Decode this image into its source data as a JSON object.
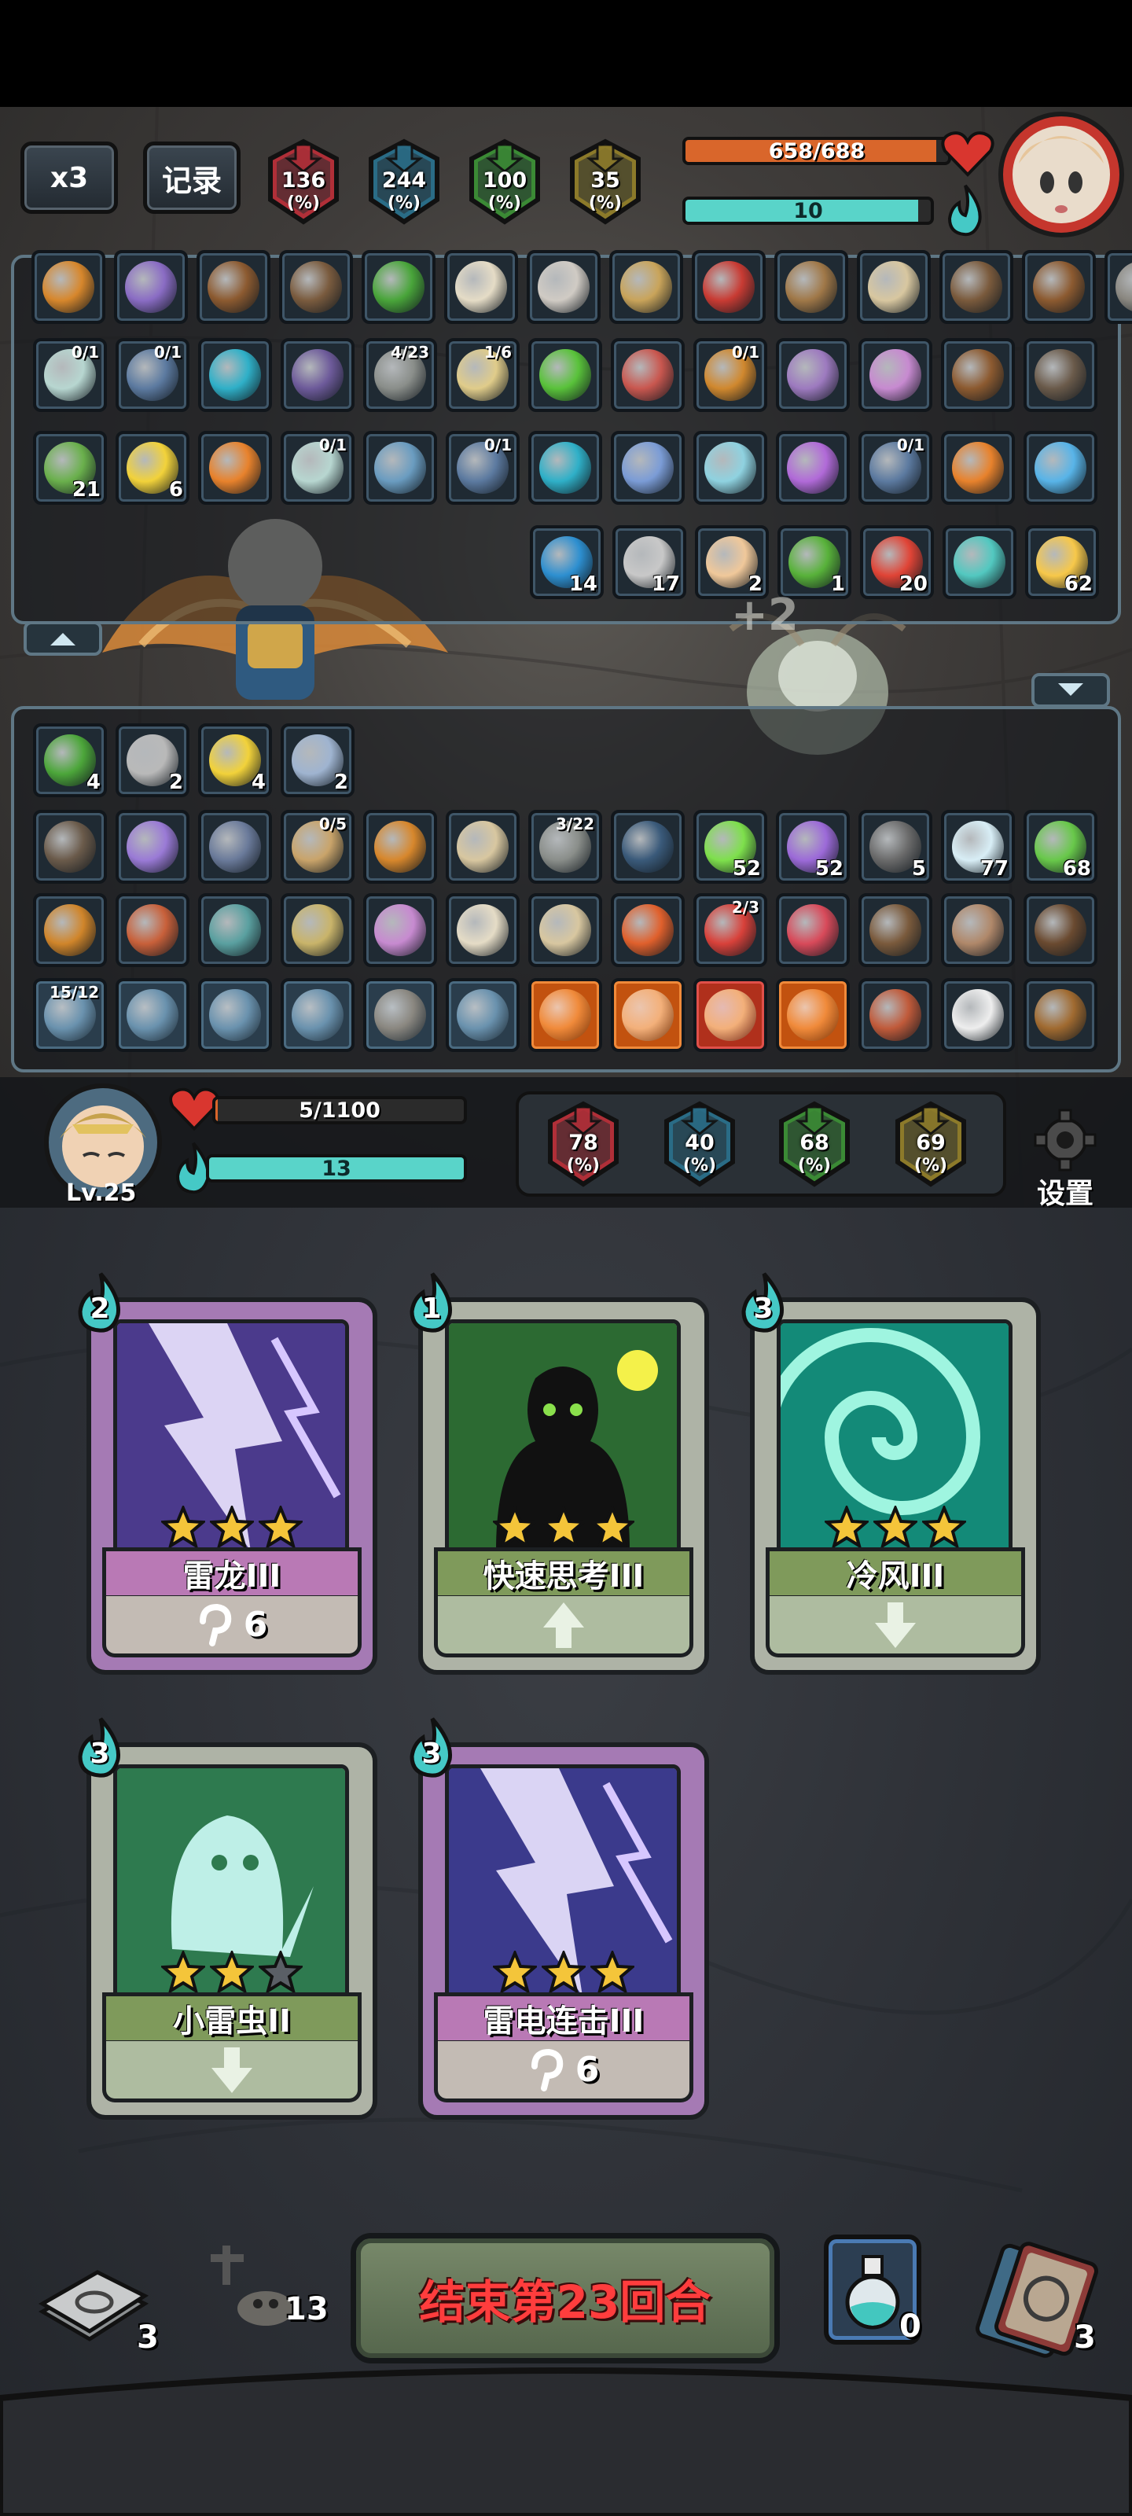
{
  "top": {
    "speed_label": "x3",
    "record_label": "记录",
    "stats": [
      {
        "icon": "attack-down-icon",
        "value": "136",
        "unit": "(%)",
        "color": "#b02f38"
      },
      {
        "icon": "mystery-icon",
        "value": "244",
        "unit": "(%)",
        "color": "#2a6c86"
      },
      {
        "icon": "defense-up-icon",
        "value": "100",
        "unit": "(%)",
        "color": "#3b8a35"
      },
      {
        "icon": "gold-arrow-icon",
        "value": "35",
        "unit": "(%)",
        "color": "#8c7a2a"
      }
    ],
    "enemy_hp": "658/688",
    "enemy_hp_fraction": 0.955,
    "enemy_energy": "10",
    "enemy_energy_fraction": 0.95
  },
  "enemy_panel": {
    "row1": [
      {
        "icon": "horn-icon"
      },
      {
        "icon": "rainbow-ring-icon"
      },
      {
        "icon": "wooden-totem-icon"
      },
      {
        "icon": "bag-icon"
      },
      {
        "icon": "green-book-icon"
      },
      {
        "icon": "bone-icon"
      },
      {
        "icon": "wing-icon"
      },
      {
        "icon": "hourglass-icon"
      },
      {
        "icon": "red-glove-icon"
      },
      {
        "icon": "shield-round-icon"
      },
      {
        "icon": "pouch-icon"
      },
      {
        "icon": "owl-icon"
      },
      {
        "icon": "wooden-totem-icon"
      },
      {
        "icon": "helmet-icon"
      }
    ],
    "row2": [
      {
        "icon": "ghost-skull-icon",
        "frac": "0/1"
      },
      {
        "icon": "shield-icon",
        "frac": "0/1"
      },
      {
        "icon": "water-drop-icon"
      },
      {
        "icon": "purple-coin-icon"
      },
      {
        "icon": "turtle-icon",
        "frac": "4/23"
      },
      {
        "icon": "scroll-icon",
        "frac": "1/6"
      },
      {
        "icon": "green-swirl-icon"
      },
      {
        "icon": "meat-icon"
      },
      {
        "icon": "claw-icon",
        "frac": "0/1"
      },
      {
        "icon": "tornado-icon"
      },
      {
        "icon": "crystal-icon"
      },
      {
        "icon": "wooden-totem-icon"
      },
      {
        "icon": "brush-icon"
      }
    ],
    "row3": [
      {
        "icon": "green-snake-icon",
        "count": "21"
      },
      {
        "icon": "lightning-icon",
        "count": "6"
      },
      {
        "icon": "fire-man-icon"
      },
      {
        "icon": "ghost-skull-icon",
        "frac": "0/1"
      },
      {
        "icon": "ice-burst-icon"
      },
      {
        "icon": "shield-icon",
        "frac": "0/1"
      },
      {
        "icon": "water-drop-icon"
      },
      {
        "icon": "gem-icon"
      },
      {
        "icon": "vortex-icon"
      },
      {
        "icon": "purple-gem-icon"
      },
      {
        "icon": "shield-icon",
        "frac": "0/1"
      },
      {
        "icon": "fire-man-icon"
      },
      {
        "icon": "blue-crystal-icon"
      }
    ],
    "row4": [
      {
        "icon": "blue-shield-icon",
        "count": "14"
      },
      {
        "icon": "drops-icon",
        "count": "17"
      },
      {
        "icon": "moon-icon",
        "count": "2"
      },
      {
        "icon": "poison-man-icon",
        "count": "1"
      },
      {
        "icon": "red-flame-icon",
        "count": "20"
      },
      {
        "icon": "teal-man-icon"
      },
      {
        "icon": "candle-icon",
        "count": "62"
      }
    ]
  },
  "player_panel": {
    "row1": [
      {
        "icon": "green-dragon-icon",
        "count": "4"
      },
      {
        "icon": "sword-icon",
        "count": "2"
      },
      {
        "icon": "lightning-icon",
        "count": "4"
      },
      {
        "icon": "shield-orb-icon",
        "count": "2"
      }
    ],
    "row2": [
      {
        "icon": "brush-icon"
      },
      {
        "icon": "egg-icon"
      },
      {
        "icon": "backpack-icon"
      },
      {
        "icon": "ring-icon",
        "frac": "0/5"
      },
      {
        "icon": "horn-icon"
      },
      {
        "icon": "pouch-icon"
      },
      {
        "icon": "turtle-icon",
        "frac": "3/22"
      },
      {
        "icon": "dark-sigil-icon"
      },
      {
        "icon": "green-slash-icon",
        "count": "52"
      },
      {
        "icon": "purple-orb-icon",
        "count": "52"
      },
      {
        "icon": "stone-icon",
        "count": "5"
      },
      {
        "icon": "snowflake-icon",
        "count": "77"
      },
      {
        "icon": "poison-skull-icon",
        "count": "68"
      }
    ],
    "row3": [
      {
        "icon": "card-icon"
      },
      {
        "icon": "doll-icon"
      },
      {
        "icon": "staff-icon"
      },
      {
        "icon": "mirror-icon"
      },
      {
        "icon": "crystal-icon"
      },
      {
        "icon": "bone-icon"
      },
      {
        "icon": "pouch-icon"
      },
      {
        "icon": "fire-pot-icon"
      },
      {
        "icon": "red-egg-icon",
        "frac": "2/3"
      },
      {
        "icon": "red-monster-icon"
      },
      {
        "icon": "owl-icon"
      },
      {
        "icon": "gauntlet-icon"
      },
      {
        "icon": "bomb-icon"
      }
    ],
    "row4": [
      {
        "icon": "trident-icon",
        "frac": "15/12",
        "style": "faded"
      },
      {
        "icon": "axe-icon",
        "style": "faded"
      },
      {
        "icon": "branch-icon",
        "style": "faded"
      },
      {
        "icon": "skull-icon",
        "style": "faded"
      },
      {
        "icon": "helmet-icon",
        "style": "faded"
      },
      {
        "icon": "thorn-icon",
        "style": "faded"
      },
      {
        "icon": "swap-icon",
        "style": "hot"
      },
      {
        "icon": "mushroom-icon",
        "style": "hot"
      },
      {
        "icon": "mushroom-icon",
        "style": "hot-red"
      },
      {
        "icon": "swap-icon",
        "style": "hot"
      },
      {
        "icon": "figure-icon"
      },
      {
        "icon": "rice-ball-icon"
      },
      {
        "icon": "bell-icon"
      }
    ]
  },
  "player": {
    "level": "Lv.25",
    "hp": "5/1100",
    "hp_fraction": 0.005,
    "energy": "13",
    "energy_fraction": 1.0,
    "stats": [
      {
        "icon": "attack-down-icon",
        "value": "78",
        "unit": "(%)",
        "color": "#b02f38"
      },
      {
        "icon": "mystery-icon",
        "value": "40",
        "unit": "(%)",
        "color": "#2a6c86"
      },
      {
        "icon": "defense-up-icon",
        "value": "68",
        "unit": "(%)",
        "color": "#3b8a35"
      },
      {
        "icon": "gold-arrow-icon",
        "value": "69",
        "unit": "(%)",
        "color": "#8c7a2a"
      }
    ],
    "settings_label": "设置"
  },
  "cards": [
    {
      "cost": "2",
      "name": "雷龙III",
      "stars": 3,
      "foot": "6",
      "foot_icon": "hook-icon",
      "theme": "purple"
    },
    {
      "cost": "1",
      "name": "快速思考III",
      "stars": 3,
      "foot": "",
      "foot_icon": "up-arrow-icon",
      "theme": "green"
    },
    {
      "cost": "3",
      "name": "冷风III",
      "stars": 3,
      "foot": "",
      "foot_icon": "down-arrow-icon",
      "theme": "teal"
    },
    {
      "cost": "3",
      "name": "小雷虫II",
      "stars": 2,
      "foot": "",
      "foot_icon": "down-arrow-icon",
      "theme": "ghost"
    },
    {
      "cost": "3",
      "name": "雷电连击III",
      "stars": 3,
      "foot": "6",
      "foot_icon": "hook-icon",
      "theme": "lightning"
    }
  ],
  "bottom": {
    "draw_pile": "3",
    "graveyard": "13",
    "end_turn_label": "结束第23回合",
    "potion": "0",
    "discard_pile": "3"
  }
}
